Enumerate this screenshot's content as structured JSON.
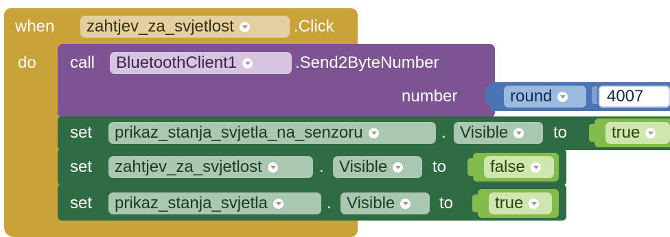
{
  "event": {
    "when_label": "when",
    "component": "zahtjev_za_svjetlost",
    "event_name": ".Click",
    "do_label": "do"
  },
  "call": {
    "call_label": "call",
    "component": "BluetoothClient1",
    "method": ".Send2ByteNumber",
    "param_label": "number",
    "round_label": "round",
    "number_value": "4007"
  },
  "sets": [
    {
      "set_label": "set",
      "component": "prikaz_stanja_svjetla_na_senzoru",
      "dot": ".",
      "property": "Visible",
      "to_label": "to",
      "value": "true"
    },
    {
      "set_label": "set",
      "component": "zahtjev_za_svjetlost",
      "dot": ".",
      "property": "Visible",
      "to_label": "to",
      "value": "false"
    },
    {
      "set_label": "set",
      "component": "prikaz_stanja_svjetla",
      "dot": ".",
      "property": "Visible",
      "to_label": "to",
      "value": "true"
    }
  ],
  "colors": {
    "event_block": "#c9a339",
    "call_block": "#7d5393",
    "setter_block": "#2f6c43",
    "math_block": "#4a74b6",
    "logic_block": "#83bb4c"
  }
}
